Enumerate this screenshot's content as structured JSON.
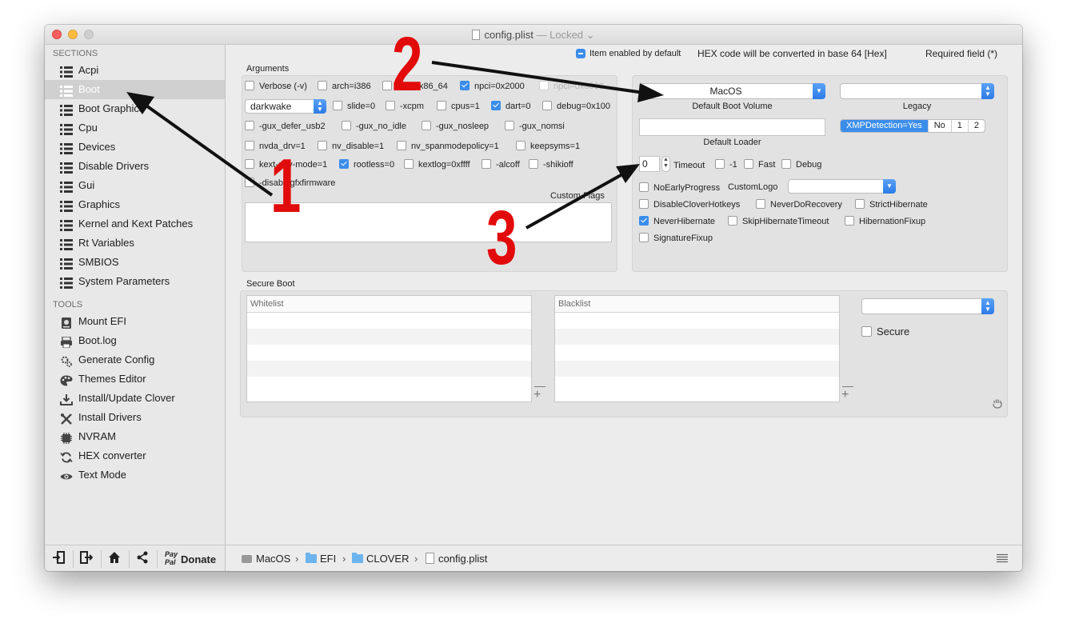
{
  "window": {
    "title": "config.plist",
    "title_status": "— Locked ⌄"
  },
  "sidebar": {
    "sections_header": "SECTIONS",
    "sections": [
      {
        "label": "Acpi"
      },
      {
        "label": "Boot",
        "selected": true
      },
      {
        "label": "Boot Graphics"
      },
      {
        "label": "Cpu"
      },
      {
        "label": "Devices"
      },
      {
        "label": "Disable Drivers"
      },
      {
        "label": "Gui"
      },
      {
        "label": "Graphics"
      },
      {
        "label": "Kernel and Kext Patches"
      },
      {
        "label": "Rt Variables"
      },
      {
        "label": "SMBIOS"
      },
      {
        "label": "System Parameters"
      }
    ],
    "tools_header": "TOOLS",
    "tools": [
      {
        "label": "Mount EFI",
        "icon": "disk-icon"
      },
      {
        "label": "Boot.log",
        "icon": "printer-icon"
      },
      {
        "label": "Generate Config",
        "icon": "gears-icon"
      },
      {
        "label": "Themes Editor",
        "icon": "palette-icon"
      },
      {
        "label": "Install/Update Clover",
        "icon": "download-icon"
      },
      {
        "label": "Install Drivers",
        "icon": "tools-icon"
      },
      {
        "label": "NVRAM",
        "icon": "chip-icon"
      },
      {
        "label": "HEX converter",
        "icon": "refresh-icon"
      },
      {
        "label": "Text Mode",
        "icon": "eye-icon"
      }
    ],
    "bottom": {
      "paypal_top": "Pay",
      "paypal_bottom": "Pal",
      "donate_label": "Donate"
    }
  },
  "legend": {
    "item_enabled_default": "Item enabled by default",
    "hex_note": "HEX code will be converted in base 64 [Hex]",
    "required_field": "Required field (*)"
  },
  "arguments": {
    "title": "Arguments",
    "row1": [
      {
        "label": "Verbose (-v)",
        "checked": false
      },
      {
        "label": "arch=i386",
        "checked": false
      },
      {
        "label": "arch=x86_64",
        "checked": false
      },
      {
        "label": "npci=0x2000",
        "checked": true
      },
      {
        "label": "npci=0x3000",
        "checked": false,
        "disabled": true
      }
    ],
    "darkwake_value": "darkwake",
    "row2": [
      {
        "label": "slide=0",
        "checked": false
      },
      {
        "label": "-xcpm",
        "checked": false
      },
      {
        "label": "cpus=1",
        "checked": false
      },
      {
        "label": "dart=0",
        "checked": true
      },
      {
        "label": "debug=0x100",
        "checked": false
      }
    ],
    "row3": [
      {
        "label": "-gux_defer_usb2",
        "checked": false
      },
      {
        "label": "-gux_no_idle",
        "checked": false
      },
      {
        "label": "-gux_nosleep",
        "checked": false
      },
      {
        "label": "-gux_nomsi",
        "checked": false
      }
    ],
    "row4": [
      {
        "label": "nvda_drv=1",
        "checked": false
      },
      {
        "label": "nv_disable=1",
        "checked": false
      },
      {
        "label": "nv_spanmodepolicy=1",
        "checked": false
      },
      {
        "label": "keepsyms=1",
        "checked": false
      }
    ],
    "row5": [
      {
        "label": "kext-dev-mode=1",
        "checked": false
      },
      {
        "label": "rootless=0",
        "checked": true
      },
      {
        "label": "kextlog=0xffff",
        "checked": false
      },
      {
        "label": "-alcoff",
        "checked": false
      },
      {
        "label": "-shikioff",
        "checked": false
      }
    ],
    "row6": [
      {
        "label": "-disablegfxfirmware",
        "checked": false
      }
    ],
    "custom_flags_label": "Custom Flags"
  },
  "boot_settings": {
    "default_boot_volume_value": "MacOS",
    "default_boot_volume_label": "Default Boot Volume",
    "legacy_label": "Legacy",
    "default_loader_label": "Default Loader",
    "xmp_options": [
      "XMPDetection=Yes",
      "No",
      "1",
      "2"
    ],
    "timeout_value": "0",
    "timeout_label": "Timeout",
    "timeout_options": [
      {
        "label": "-1",
        "checked": false
      },
      {
        "label": "Fast",
        "checked": false
      },
      {
        "label": "Debug",
        "checked": false
      }
    ],
    "no_early_progress": {
      "label": "NoEarlyProgress",
      "checked": false
    },
    "custom_logo_label": "CustomLogo",
    "flags": [
      {
        "label": "DisableCloverHotkeys",
        "checked": false
      },
      {
        "label": "NeverDoRecovery",
        "checked": false
      },
      {
        "label": "StrictHibernate",
        "checked": false
      },
      {
        "label": "NeverHibernate",
        "checked": true
      },
      {
        "label": "SkipHibernateTimeout",
        "checked": false
      },
      {
        "label": "HibernationFixup",
        "checked": false
      },
      {
        "label": "SignatureFixup",
        "checked": false
      }
    ]
  },
  "secure_boot": {
    "title": "Secure Boot",
    "whitelist_header": "Whitelist",
    "blacklist_header": "Blacklist",
    "secure_label": "Secure",
    "secure_checked": false,
    "minus": "—",
    "plus": "+"
  },
  "pathbar": {
    "items": [
      "MacOS",
      "EFI",
      "CLOVER",
      "config.plist"
    ],
    "separator": "›"
  },
  "annotations": {
    "n1": "1",
    "n2": "2",
    "n3": "3",
    "color": "#e20b0b"
  },
  "colors": {
    "accent": "#3b8dea",
    "annotation_red": "#e20b0b",
    "close": "#fc605c",
    "minimize": "#fdbc40",
    "zoom": "#cfcfcf"
  }
}
